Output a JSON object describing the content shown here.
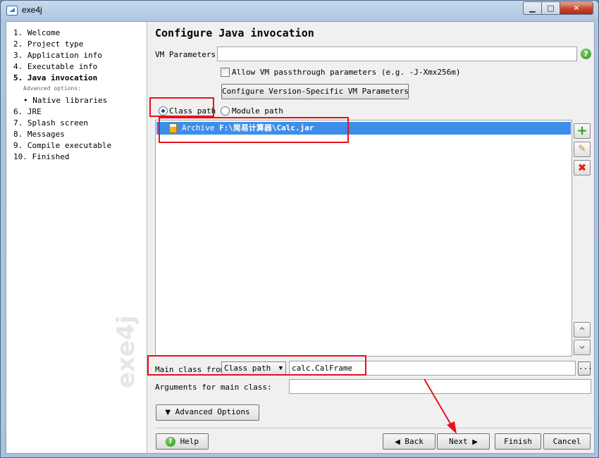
{
  "window": {
    "title": "exe4j",
    "controls": {
      "minimize": "▁",
      "maximize": "□",
      "close": "✕"
    }
  },
  "sidebar": {
    "steps": [
      "1.  Welcome",
      "2.  Project type",
      "3.  Application info",
      "4.  Executable info",
      "5.  Java invocation",
      "6.  JRE",
      "7.  Splash screen",
      "8.  Messages",
      "9.  Compile executable",
      "10.  Finished"
    ],
    "advanced_header": "Advanced options:",
    "advanced_item": "• Native libraries",
    "watermark": "exe4j"
  },
  "main": {
    "title": "Configure Java invocation",
    "vm_parameters_label": "VM Parameters:",
    "vm_parameters_value": "",
    "help_glyph": "?",
    "passthrough_label": "Allow VM passthrough parameters (e.g. -J-Xmx256m)",
    "configure_vm_button": "Configure Version-Specific VM Parameters",
    "class_path_radio": "Class path",
    "module_path_radio": "Module path",
    "classpath_entry": {
      "type": "Archive",
      "path": "F:\\简易计算器\\Calc.jar"
    },
    "side_buttons": {
      "add": "+",
      "edit": "✎",
      "remove": "✖",
      "up": "⌃",
      "down": "⌄"
    },
    "main_class_label": "Main class from",
    "main_class_source": "Class path",
    "main_class_value": "calc.CalFrame",
    "browse_button": "...",
    "arguments_label": "Arguments for main class:",
    "arguments_value": "",
    "advanced_options_button": "Advanced Options"
  },
  "footer": {
    "help": "Help",
    "back": "Back",
    "next": "Next",
    "finish": "Finish",
    "cancel": "Cancel"
  },
  "colors": {
    "highlight": "#3d8ee8",
    "annotation": "#e8101b"
  }
}
